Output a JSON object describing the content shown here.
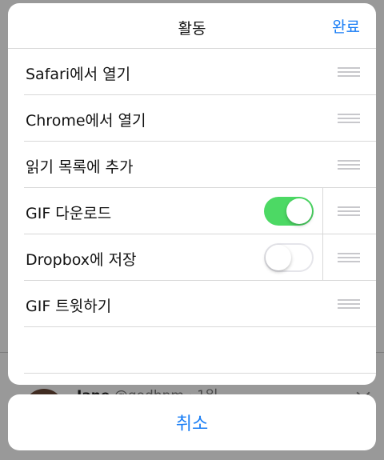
{
  "background": {
    "tweet_name": "Jane",
    "tweet_handle": "@godhnm · 1일"
  },
  "sheet": {
    "title": "활동",
    "done_label": "완료",
    "rows": [
      {
        "label": "Safari에서 열기",
        "toggle": null
      },
      {
        "label": "Chrome에서 열기",
        "toggle": null
      },
      {
        "label": "읽기 목록에 추가",
        "toggle": null
      },
      {
        "label": "GIF 다운로드",
        "toggle": "on"
      },
      {
        "label": "Dropbox에 저장",
        "toggle": "off"
      },
      {
        "label": "GIF 트윗하기",
        "toggle": null
      }
    ]
  },
  "cancel_label": "취소",
  "colors": {
    "accent": "#1a7ef5",
    "toggle_on": "#4cd964"
  },
  "icons": {
    "drag_handle": "reorder-icon"
  }
}
